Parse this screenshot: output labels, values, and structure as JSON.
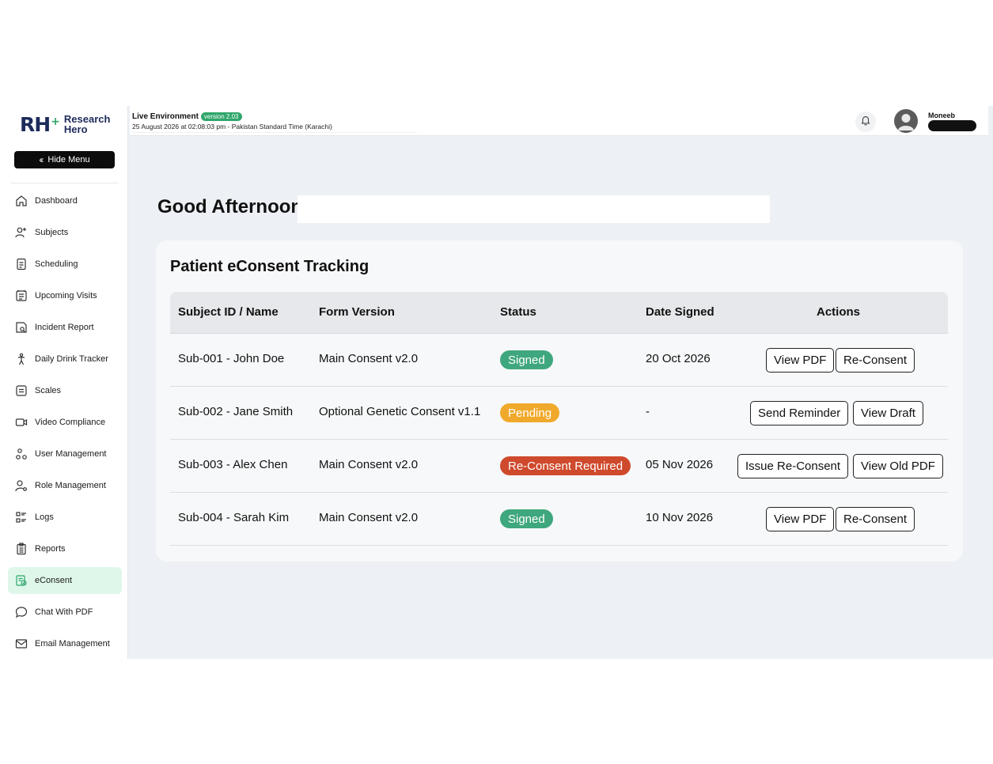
{
  "brand": {
    "mark": "RH",
    "line1": "Research",
    "line2": "Hero"
  },
  "sidebar": {
    "hide_menu_label": "Hide Menu",
    "items": [
      {
        "label": "Dashboard",
        "icon": "home-icon"
      },
      {
        "label": "Subjects",
        "icon": "user-plus-icon"
      },
      {
        "label": "Scheduling",
        "icon": "document-icon"
      },
      {
        "label": "Upcoming Visits",
        "icon": "calendar-list-icon"
      },
      {
        "label": "Incident Report",
        "icon": "report-icon"
      },
      {
        "label": "Daily Drink Tracker",
        "icon": "person-icon"
      },
      {
        "label": "Scales",
        "icon": "scales-icon"
      },
      {
        "label": "Video Compliance",
        "icon": "video-icon"
      },
      {
        "label": "User Management",
        "icon": "users-icon"
      },
      {
        "label": "Role Management",
        "icon": "user-gear-icon"
      },
      {
        "label": "Logs",
        "icon": "list-icon"
      },
      {
        "label": "Reports",
        "icon": "clipboard-icon"
      },
      {
        "label": "eConsent",
        "icon": "econsent-icon",
        "active": true
      },
      {
        "label": "Chat With PDF",
        "icon": "chat-icon"
      },
      {
        "label": "Email Management",
        "icon": "mail-icon"
      }
    ]
  },
  "header": {
    "environment": "Live Environment",
    "version": "version 2.03",
    "datetime": "25 August 2026 at 02:08:03 pm - Pakistan Standard Time (Karachi)",
    "user_name": "Moneeb"
  },
  "main": {
    "greeting": "Good Afternoon",
    "card_title": "Patient eConsent Tracking",
    "columns": [
      "Subject ID / Name",
      "Form Version",
      "Status",
      "Date Signed",
      "Actions"
    ],
    "rows": [
      {
        "subject": "Sub-001 - John Doe",
        "form": "Main Consent v2.0",
        "status": "Signed",
        "status_kind": "signed",
        "date": "20 Oct 2026",
        "actions": [
          "View PDF",
          "Re-Consent"
        ]
      },
      {
        "subject": "Sub-002 - Jane Smith",
        "form": "Optional Genetic Consent v1.1",
        "status": "Pending",
        "status_kind": "pending",
        "date": "-",
        "actions": [
          "Send Reminder",
          "View Draft"
        ]
      },
      {
        "subject": "Sub-003 - Alex Chen",
        "form": "Main Consent v2.0",
        "status": "Re-Consent Required",
        "status_kind": "reconsent",
        "date": "05 Nov 2026",
        "actions": [
          "Issue Re-Consent",
          "View Old PDF"
        ]
      },
      {
        "subject": "Sub-004 - Sarah Kim",
        "form": "Main Consent v2.0",
        "status": "Signed",
        "status_kind": "signed",
        "date": "10 Nov 2026",
        "actions": [
          "View PDF",
          "Re-Consent"
        ]
      }
    ]
  },
  "colors": {
    "accent": "#2fa66b",
    "signed": "#3fa77d",
    "pending": "#f0a92b",
    "reconsent": "#cf4a2c",
    "active_nav": "#dff7ea"
  }
}
